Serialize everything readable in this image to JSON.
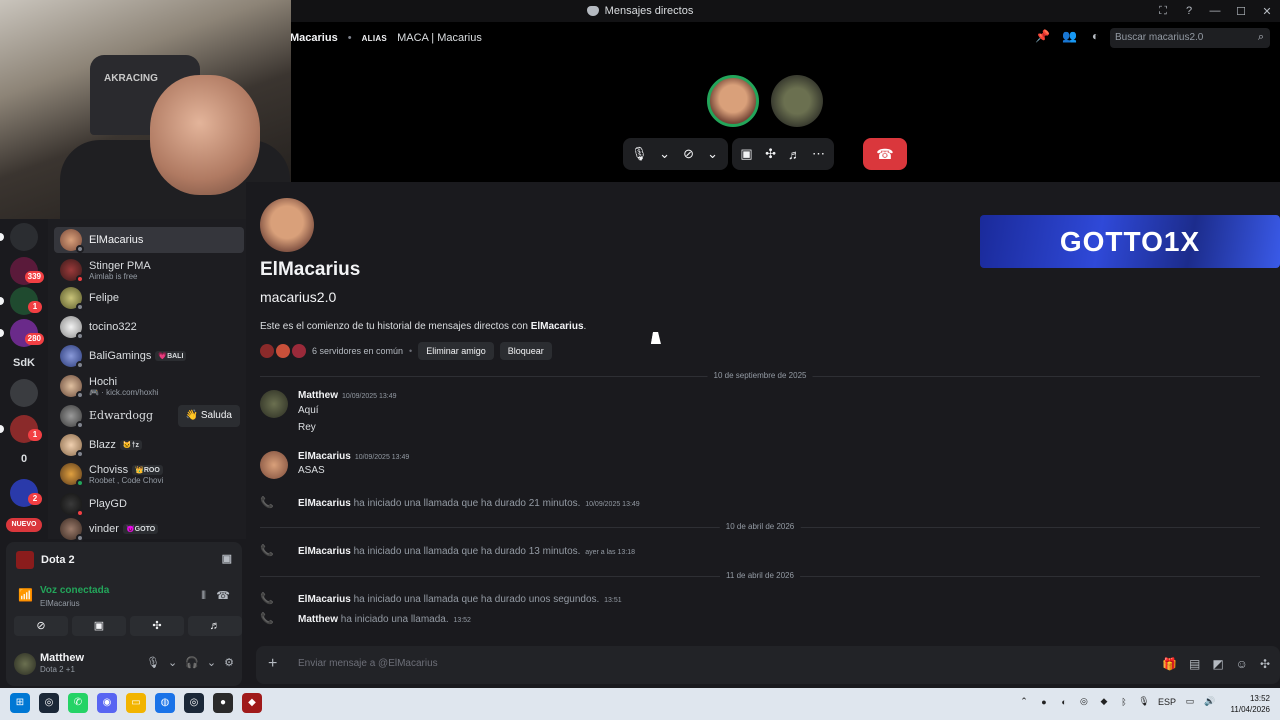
{
  "window": {
    "title": "Mensajes directos",
    "controls": [
      "⛶",
      "?",
      "—",
      "☐",
      "✕"
    ]
  },
  "header": {
    "dm_name": "Macarius",
    "alias_label": "ALIAS",
    "alias_value": "MACA | Macarius",
    "search_placeholder": "Buscar macarius2.0"
  },
  "webcam": {
    "chair_brand": "AKRACING"
  },
  "servers": [
    {
      "label": "",
      "badge": ""
    },
    {
      "label": "",
      "badge": "339"
    },
    {
      "label": "",
      "badge": "1"
    },
    {
      "label": "",
      "badge": "280"
    },
    {
      "label": "SdK",
      "badge": ""
    },
    {
      "label": "",
      "badge": ""
    },
    {
      "label": "",
      "badge": "1"
    },
    {
      "label": "0",
      "badge": ""
    },
    {
      "label": "",
      "badge": "2"
    }
  ],
  "nuevo_label": "NUEVO",
  "dms": [
    {
      "name": "ElMacarius",
      "sub": "",
      "tag": "",
      "status": "#80848e"
    },
    {
      "name": "Stinger PMA",
      "sub": "Aimlab is free",
      "tag": "",
      "status": "#f23f43"
    },
    {
      "name": "Felipe",
      "sub": "",
      "tag": "",
      "status": "#80848e"
    },
    {
      "name": "tocino322",
      "sub": "",
      "tag": "",
      "status": "#80848e"
    },
    {
      "name": "BaliGamings",
      "sub": "",
      "tag": "💗BALI",
      "status": "#80848e"
    },
    {
      "name": "Hochi",
      "sub": "🎮 · kick.com/hoxhi",
      "tag": "",
      "status": "#80848e"
    },
    {
      "name": "Edwardogg",
      "sub": "",
      "tag": "",
      "status": "#80848e"
    },
    {
      "name": "Blazz",
      "sub": "",
      "tag": "🐱†z",
      "status": "#80848e"
    },
    {
      "name": "Choviss",
      "sub": "Roobet , Code Chovi",
      "tag": "👑ROO",
      "status": "#23a55a"
    },
    {
      "name": "PlayGD",
      "sub": "",
      "tag": "",
      "status": "#f23f43"
    },
    {
      "name": "vinder",
      "sub": "",
      "tag": "😈GOTO",
      "status": "#80848e"
    }
  ],
  "saluda_label": "👋 Saluda",
  "game_panel": {
    "title": "Dota 2"
  },
  "voice": {
    "status": "Voz conectada",
    "channel": "ElMacarius"
  },
  "user": {
    "name": "Matthew",
    "activity": "Dota 2 +1"
  },
  "intro": {
    "display_name": "ElMacarius",
    "username": "macarius2.0",
    "text_prefix": "Este es el comienzo de tu historial de mensajes directos con ",
    "text_name": "ElMacarius",
    "text_suffix": ".",
    "mutual": "6 servidores en común",
    "remove_friend": "Eliminar amigo",
    "block": "Bloquear"
  },
  "banner_text": "GOTTO1X",
  "dividers": [
    "10 de septiembre de 2025",
    "10 de abril de 2026",
    "11 de abril de 2026"
  ],
  "messages": [
    {
      "author": "Matthew",
      "time": "10/09/2025 13:49",
      "lines": [
        "Aquí",
        "Rey"
      ]
    },
    {
      "author": "ElMacarius",
      "time": "10/09/2025 13:49",
      "lines": [
        "ASAS"
      ]
    }
  ],
  "system_messages": [
    {
      "author": "ElMacarius",
      "text": "ha iniciado una llamada que ha durado 21 minutos.",
      "time": "10/09/2025 13:49"
    },
    {
      "author": "ElMacarius",
      "text": "ha iniciado una llamada que ha durado 13 minutos.",
      "time": "ayer a las 13:18"
    },
    {
      "author": "ElMacarius",
      "text": "ha iniciado una llamada que ha durado unos segundos.",
      "time": "13:51"
    },
    {
      "author": "Matthew",
      "text": "ha iniciado una llamada.",
      "time": "13:52"
    }
  ],
  "composer_placeholder": "Enviar mensaje a @ElMacarius",
  "taskbar": {
    "lang": "ESP",
    "time": "13:52",
    "date": "11/04/2026"
  },
  "colors": {
    "online": "#23a55a",
    "dnd": "#f23f43",
    "hangup": "#da373c",
    "brand_banner": "#2f49d8"
  }
}
